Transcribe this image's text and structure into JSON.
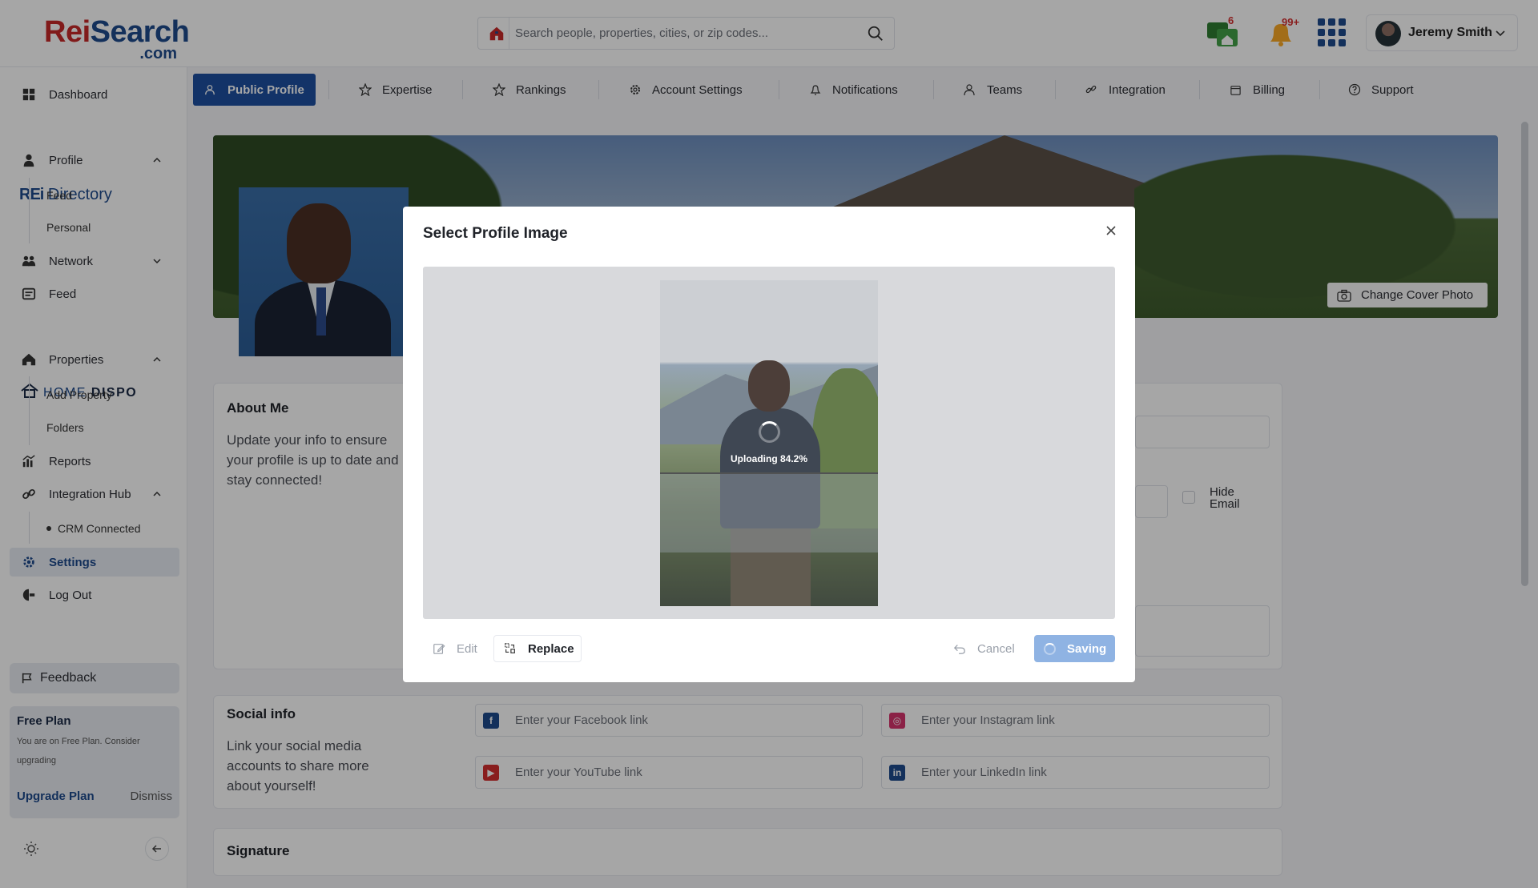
{
  "header": {
    "logo_main_1": "Rei",
    "logo_main_2": "Search",
    "logo_suffix": ".com",
    "search_placeholder": "Search people, properties, cities, or zip codes...",
    "messages_badge": "6",
    "notifications_badge": "99+",
    "user_name": "Jeremy Smith",
    "colors": {
      "brand_blue": "#1e4a8c",
      "brand_red": "#c62828",
      "badge_red": "#d32f2f",
      "icon_green": "#2e7d32",
      "bell_orange": "#f9a825"
    }
  },
  "sidebar": {
    "dashboard": "Dashboard",
    "rei_brand_1": "REi",
    "rei_brand_2": "Directory",
    "profile": "Profile",
    "profile_feed": "Feed",
    "profile_personal": "Personal",
    "network": "Network",
    "feed": "Feed",
    "home_brand_1": "HOME",
    "home_brand_2": "DISPO",
    "properties": "Properties",
    "add_property": "Add Property",
    "folders": "Folders",
    "reports": "Reports",
    "integration_hub": "Integration Hub",
    "crm_connected": "CRM Connected",
    "settings": "Settings",
    "log_out": "Log Out",
    "feedback": "Feedback",
    "plan": {
      "title": "Free Plan",
      "desc": "You are on Free Plan. Consider upgrading",
      "upgrade": "Upgrade Plan",
      "dismiss": "Dismiss"
    }
  },
  "tabs": [
    "Public Profile",
    "Expertise",
    "Rankings",
    "Account Settings",
    "Notifications",
    "Teams",
    "Integration",
    "Billing",
    "Support"
  ],
  "main": {
    "change_cover": "Change Cover Photo",
    "about_title": "About Me",
    "about_desc": "Update your info to ensure your profile is up to date and stay connected!",
    "hide_email": "Hide Email",
    "social_title": "Social info",
    "social_desc": "Link your social media accounts to share more about yourself!",
    "facebook_placeholder": "Enter your Facebook link",
    "instagram_placeholder": "Enter your Instagram link",
    "youtube_placeholder": "Enter your YouTube link",
    "linkedin_placeholder": "Enter your LinkedIn link",
    "signature_title": "Signature"
  },
  "modal": {
    "title": "Select Profile Image",
    "upload_status": "Uploading 84.2%",
    "upload_progress": 0.842,
    "edit": "Edit",
    "replace": "Replace",
    "cancel": "Cancel",
    "saving": "Saving"
  }
}
